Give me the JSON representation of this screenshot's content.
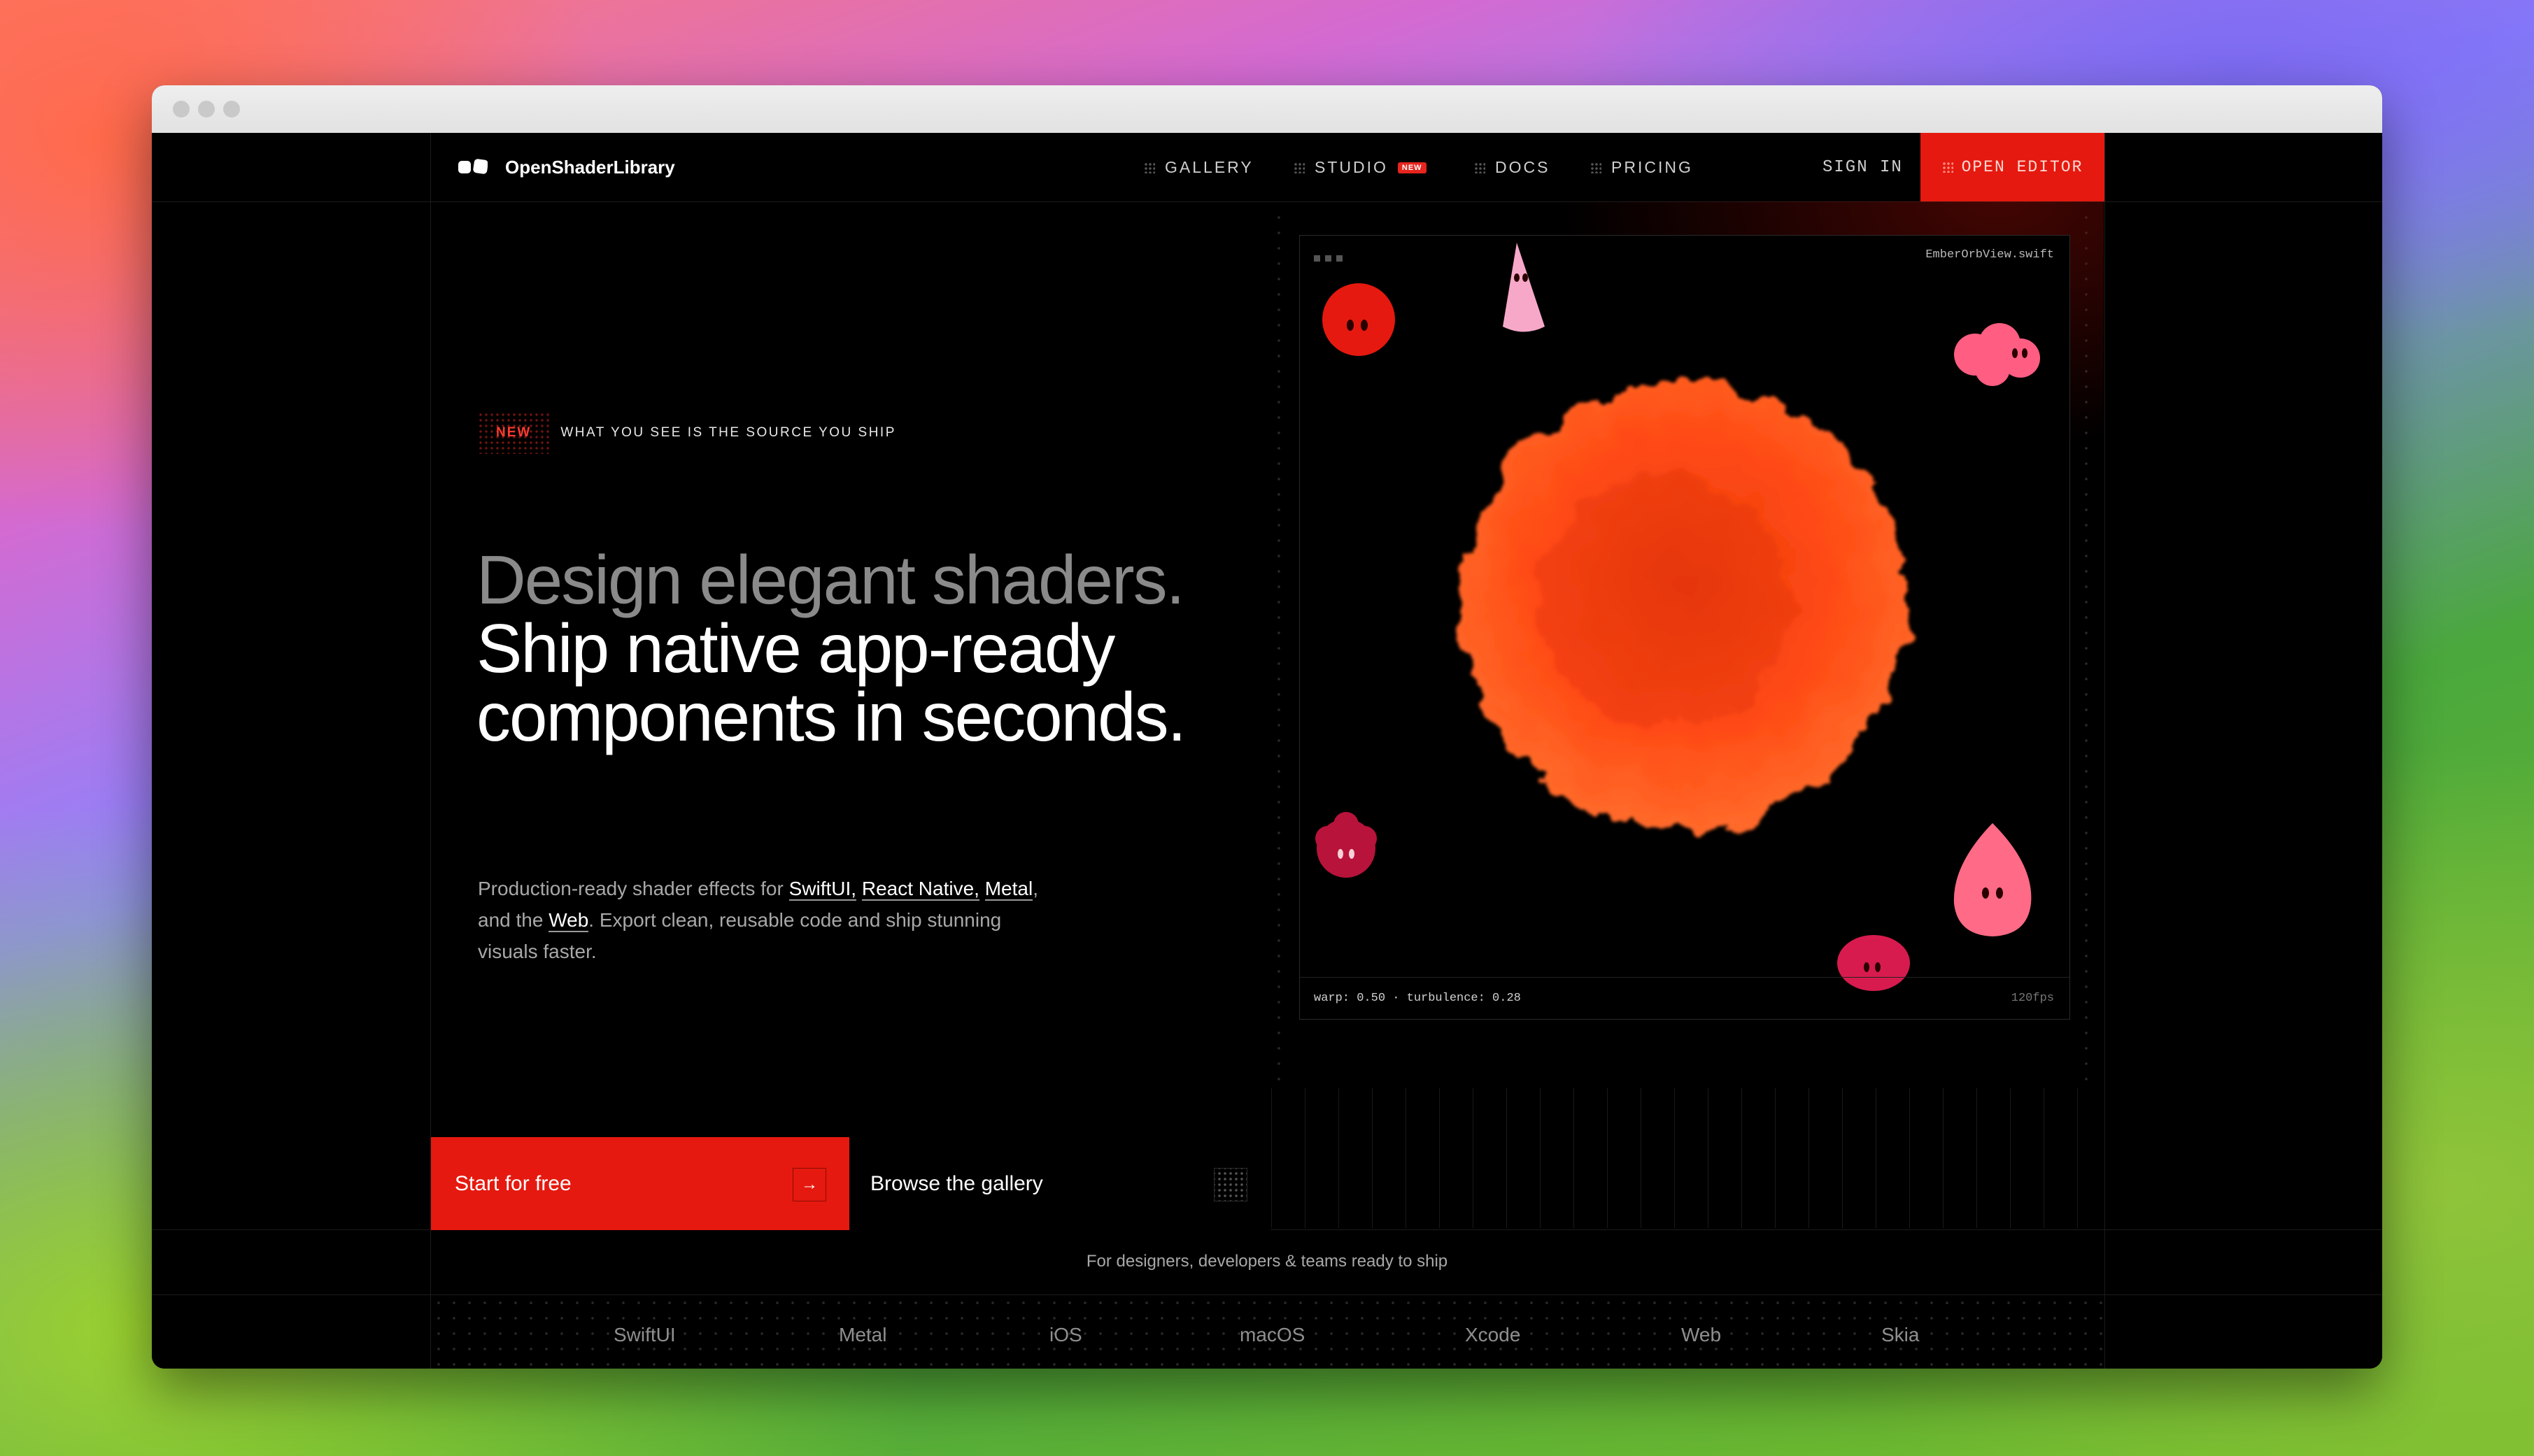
{
  "brand": {
    "name": "OpenShaderLibrary"
  },
  "nav": {
    "items": [
      {
        "label": "GALLERY"
      },
      {
        "label": "STUDIO",
        "badge": "NEW"
      },
      {
        "label": "DOCS"
      },
      {
        "label": "PRICING"
      }
    ],
    "sign_in": "SIGN IN",
    "open_editor": "OPEN EDITOR"
  },
  "hero": {
    "tag_new": "NEW",
    "tag_text": "WHAT YOU SEE IS THE SOURCE YOU SHIP",
    "headline_1": "Design elegant shaders.",
    "headline_2": "Ship native app-ready",
    "headline_3": "components in seconds.",
    "desc_prefix": "Production-ready shader effects for ",
    "desc_swiftui": "SwiftUI,",
    "desc_react": "React Native,",
    "desc_metal": "Metal",
    "desc_and": ", and the ",
    "desc_web": "Web",
    "desc_suffix": ". Export clean, reusable code and ship stunning visuals faster.",
    "cta_primary": "Start for free",
    "cta_primary_icon": "→",
    "cta_secondary": "Browse the gallery"
  },
  "preview": {
    "filename": "EmberOrbView.swift",
    "params": "warp: 0.50 · turbulence: 0.28",
    "fps": "120fps"
  },
  "audience": "For designers, developers & teams ready to ship",
  "platforms": [
    "SwiftUI",
    "Metal",
    "iOS",
    "macOS",
    "Xcode",
    "Web",
    "Skia"
  ],
  "colors": {
    "accent": "#e5190f",
    "background": "#000000",
    "orb": "#ff4a14"
  },
  "icons": [
    "logo-mark-icon",
    "grip-icon",
    "arrow-right-icon",
    "grid-icon"
  ]
}
